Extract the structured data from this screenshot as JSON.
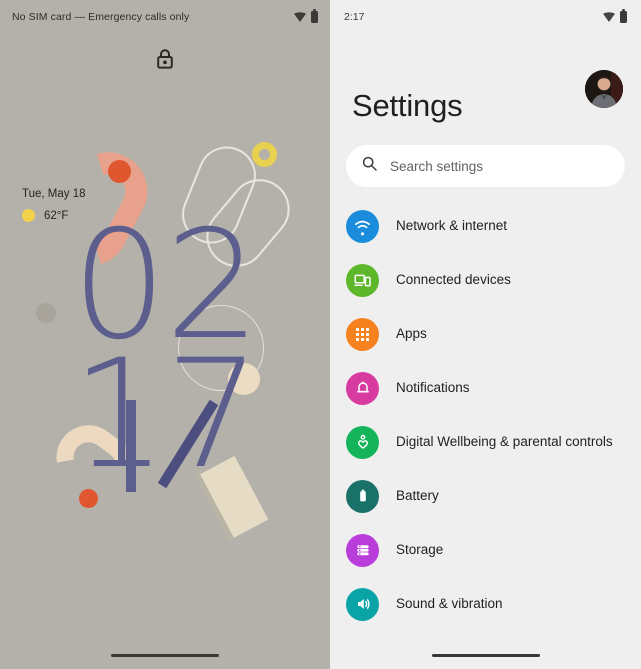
{
  "lock_screen": {
    "status": {
      "carrier_text": "No SIM card — Emergency calls only",
      "wifi_icon": "wifi-icon",
      "battery_icon": "battery-icon"
    },
    "lock_icon": "lock-closed-icon",
    "date": "Tue, May 18",
    "weather": {
      "condition_icon": "sun-icon",
      "temperature": "62°F"
    },
    "clock": {
      "hours": "02",
      "minutes": "17"
    },
    "gesture_bar": "home-gesture-bar",
    "colors": {
      "wallpaper": "#b4b1aa",
      "clock": "#5c5f8e",
      "salmon": "#e8a18c",
      "orange": "#e0562f",
      "yellow": "#e8d14f",
      "beige": "#ecd9bf",
      "red": "#d8482f"
    }
  },
  "settings_screen": {
    "status": {
      "time": "2:17",
      "wifi_icon": "wifi-icon",
      "battery_icon": "battery-icon"
    },
    "avatar": "user-avatar",
    "title": "Settings",
    "search": {
      "placeholder": "Search settings",
      "icon": "search-icon"
    },
    "items": [
      {
        "label": "Network & internet",
        "icon": "wifi-icon",
        "color": "#1b8cdb"
      },
      {
        "label": "Connected devices",
        "icon": "devices-icon",
        "color": "#5cb72a"
      },
      {
        "label": "Apps",
        "icon": "apps-grid-icon",
        "color": "#f5821f"
      },
      {
        "label": "Notifications",
        "icon": "bell-icon",
        "color": "#d83ba0"
      },
      {
        "label": "Digital Wellbeing & parental controls",
        "icon": "heart-icon",
        "color": "#16b45a"
      },
      {
        "label": "Battery",
        "icon": "battery-icon",
        "color": "#1a7167"
      },
      {
        "label": "Storage",
        "icon": "storage-icon",
        "color": "#b83ddb"
      },
      {
        "label": "Sound & vibration",
        "icon": "volume-icon",
        "color": "#0ba4a6"
      }
    ],
    "gesture_bar": "home-gesture-bar",
    "colors": {
      "background": "#f0eff0",
      "search_bg": "#ffffff",
      "text": "#1f1f1f"
    }
  }
}
